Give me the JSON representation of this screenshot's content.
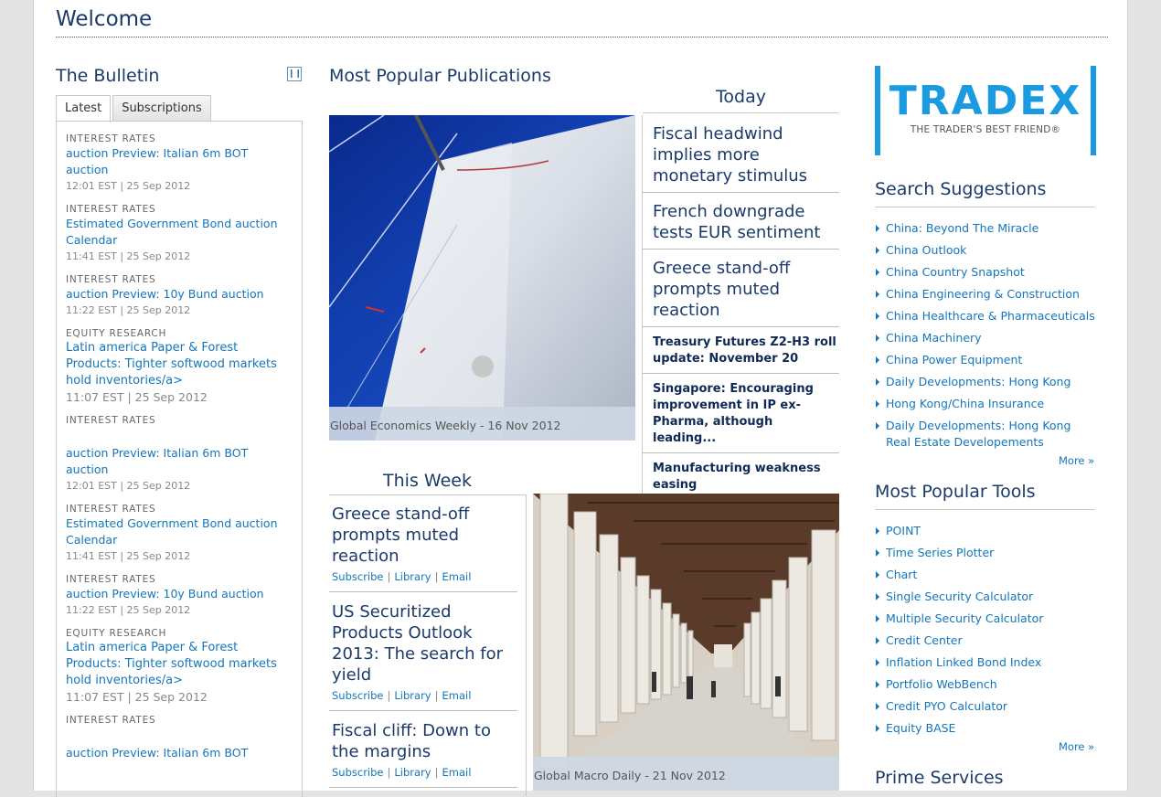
{
  "page": {
    "title": "Welcome"
  },
  "bulletin": {
    "title": "The Bulletin",
    "pause_icon": "pause-icon",
    "tabs": [
      {
        "label": "Latest"
      },
      {
        "label": "Subscriptions"
      }
    ],
    "items": [
      {
        "category": "INTEREST RATES",
        "title": "auction Preview: Italian 6m BOT auction",
        "time": "12:01 EST | 25 Sep 2012"
      },
      {
        "category": "INTEREST RATES",
        "title": "Estimated Government Bond auction Calendar",
        "time": "11:41 EST | 25 Sep 2012"
      },
      {
        "category": "INTEREST RATES",
        "title": "auction Preview: 10y Bund auction",
        "time": "11:22 EST | 25 Sep 2012"
      },
      {
        "category": "EQUITY RESEARCH",
        "title": "Latin america Paper & Forest Products: Tighter softwood markets hold inventories/a>",
        "time": "11:07 EST | 25 Sep 2012"
      },
      {
        "category": "INTEREST RATES",
        "title": "auction Preview: Italian 6m BOT auction",
        "time": "12:01 EST | 25 Sep 2012"
      },
      {
        "category": "INTEREST RATES",
        "title": "Estimated Government Bond auction Calendar",
        "time": "11:41 EST | 25 Sep 2012"
      },
      {
        "category": "INTEREST RATES",
        "title": "auction Preview: 10y Bund auction",
        "time": "11:22 EST | 25 Sep 2012"
      },
      {
        "category": "EQUITY RESEARCH",
        "title": "Latin america Paper & Forest Products: Tighter softwood markets hold inventories/a>",
        "time": "11:07 EST | 25 Sep 2012"
      },
      {
        "category": "INTEREST RATES",
        "title": "auction Preview: Italian 6m BOT",
        "time": ""
      }
    ]
  },
  "publications": {
    "title": "Most Popular Publications",
    "today_label": "Today",
    "hero1_caption": "Global Economics Weekly - 16 Nov 2012",
    "today_items": [
      {
        "title": "Fiscal headwind implies more monetary stimulus",
        "size": "large"
      },
      {
        "title": "French downgrade tests EUR sentiment",
        "size": "large"
      },
      {
        "title": "Greece stand-off prompts muted reaction",
        "size": "large"
      },
      {
        "title": "Treasury Futures Z2-H3 roll update: November 20",
        "size": "small"
      },
      {
        "title": "Singapore: Encouraging improvement in IP ex-Pharma, although leading...",
        "size": "small"
      },
      {
        "title": "Manufacturing weakness easing",
        "size": "small"
      }
    ],
    "this_week_label": "This Week",
    "week_items": [
      {
        "title": "Greece stand-off prompts muted reaction"
      },
      {
        "title": "US Securitized Products Outlook 2013: The search for yield"
      },
      {
        "title": "Fiscal cliff: Down to the margins"
      }
    ],
    "links": {
      "subscribe": "Subscribe",
      "library": "Library",
      "email": "Email",
      "separator": "|"
    },
    "hero2_caption": "Global Macro Daily - 21 Nov 2012"
  },
  "tradex": {
    "logo": "TRADEX",
    "tagline": "THE TRADER'S BEST FRIEND®",
    "accent": "#1a9ae0"
  },
  "search_suggestions": {
    "title": "Search Suggestions",
    "items": [
      "China: Beyond The Miracle",
      "China Outlook",
      "China Country Snapshot",
      "China Engineering & Construction",
      "China Healthcare & Pharmaceuticals",
      "China Machinery",
      "China Power Equipment",
      "Daily Developments: Hong Kong",
      "Hong Kong/China Insurance",
      "Daily Developments: Hong Kong Real Estate Developements"
    ],
    "more": "More »"
  },
  "tools": {
    "title": "Most Popular Tools",
    "items": [
      "POINT",
      "Time Series Plotter",
      "Chart",
      "Single Security Calculator",
      "Multiple Security Calculator",
      "Credit Center",
      "Inflation Linked Bond Index",
      "Portfolio WebBench",
      "Credit PYO Calculator",
      "Equity BASE"
    ],
    "more": "More »"
  },
  "prime": {
    "title": "Prime Services"
  }
}
